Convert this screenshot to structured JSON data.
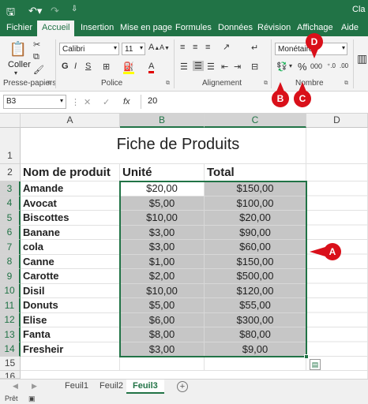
{
  "window": {
    "title": "Cla"
  },
  "ribbon_tabs": [
    "Fichier",
    "Accueil",
    "Insertion",
    "Mise en page",
    "Formules",
    "Données",
    "Révision",
    "Affichage",
    "Aide"
  ],
  "active_tab": "Accueil",
  "clipboard": {
    "paste_label": "Coller",
    "group_label": "Presse-papiers"
  },
  "font": {
    "name": "Calibri",
    "size": "11",
    "group_label": "Police"
  },
  "alignment": {
    "group_label": "Alignement"
  },
  "number": {
    "format": "Monétaire",
    "group_label": "Nombre",
    "percent": "%",
    "thousands": "000"
  },
  "formula_bar": {
    "cell_ref": "B3",
    "cancel": "✕",
    "enter": "✓",
    "fx": "fx",
    "value": "20"
  },
  "columns": [
    "A",
    "B",
    "C",
    "D"
  ],
  "rows": [
    "1",
    "2",
    "3",
    "4",
    "5",
    "6",
    "7",
    "8",
    "9",
    "10",
    "11",
    "12",
    "13",
    "14",
    "15",
    "16"
  ],
  "sheet": {
    "title": "Fiche de Produits",
    "headers": {
      "name": "Nom de produit",
      "unit": "Unité",
      "total": "Total"
    },
    "products": [
      {
        "name": "Amande",
        "unit": "$20,00",
        "total": "$150,00"
      },
      {
        "name": "Avocat",
        "unit": "$5,00",
        "total": "$100,00"
      },
      {
        "name": "Biscottes",
        "unit": "$10,00",
        "total": "$20,00"
      },
      {
        "name": "Banane",
        "unit": "$3,00",
        "total": "$90,00"
      },
      {
        "name": "cola",
        "unit": "$3,00",
        "total": "$60,00"
      },
      {
        "name": "Canne",
        "unit": "$1,00",
        "total": "$150,00"
      },
      {
        "name": "Carotte",
        "unit": "$2,00",
        "total": "$500,00"
      },
      {
        "name": "Disil",
        "unit": "$10,00",
        "total": "$120,00"
      },
      {
        "name": "Donuts",
        "unit": "$5,00",
        "total": "$55,00"
      },
      {
        "name": "Elise",
        "unit": "$6,00",
        "total": "$300,00"
      },
      {
        "name": "Fanta",
        "unit": "$8,00",
        "total": "$80,00"
      },
      {
        "name": "Fresheir",
        "unit": "$3,00",
        "total": "$9,00"
      }
    ]
  },
  "sheet_tabs": [
    "Feuil1",
    "Feuil2",
    "Feuil3"
  ],
  "active_sheet": "Feuil3",
  "status": {
    "text": "Prêt"
  },
  "markers": {
    "a": "A",
    "b": "B",
    "c": "C",
    "d": "D"
  },
  "colors": {
    "brand": "#217346",
    "selection_fill": "#c6c6c6",
    "marker": "#d9101a"
  }
}
